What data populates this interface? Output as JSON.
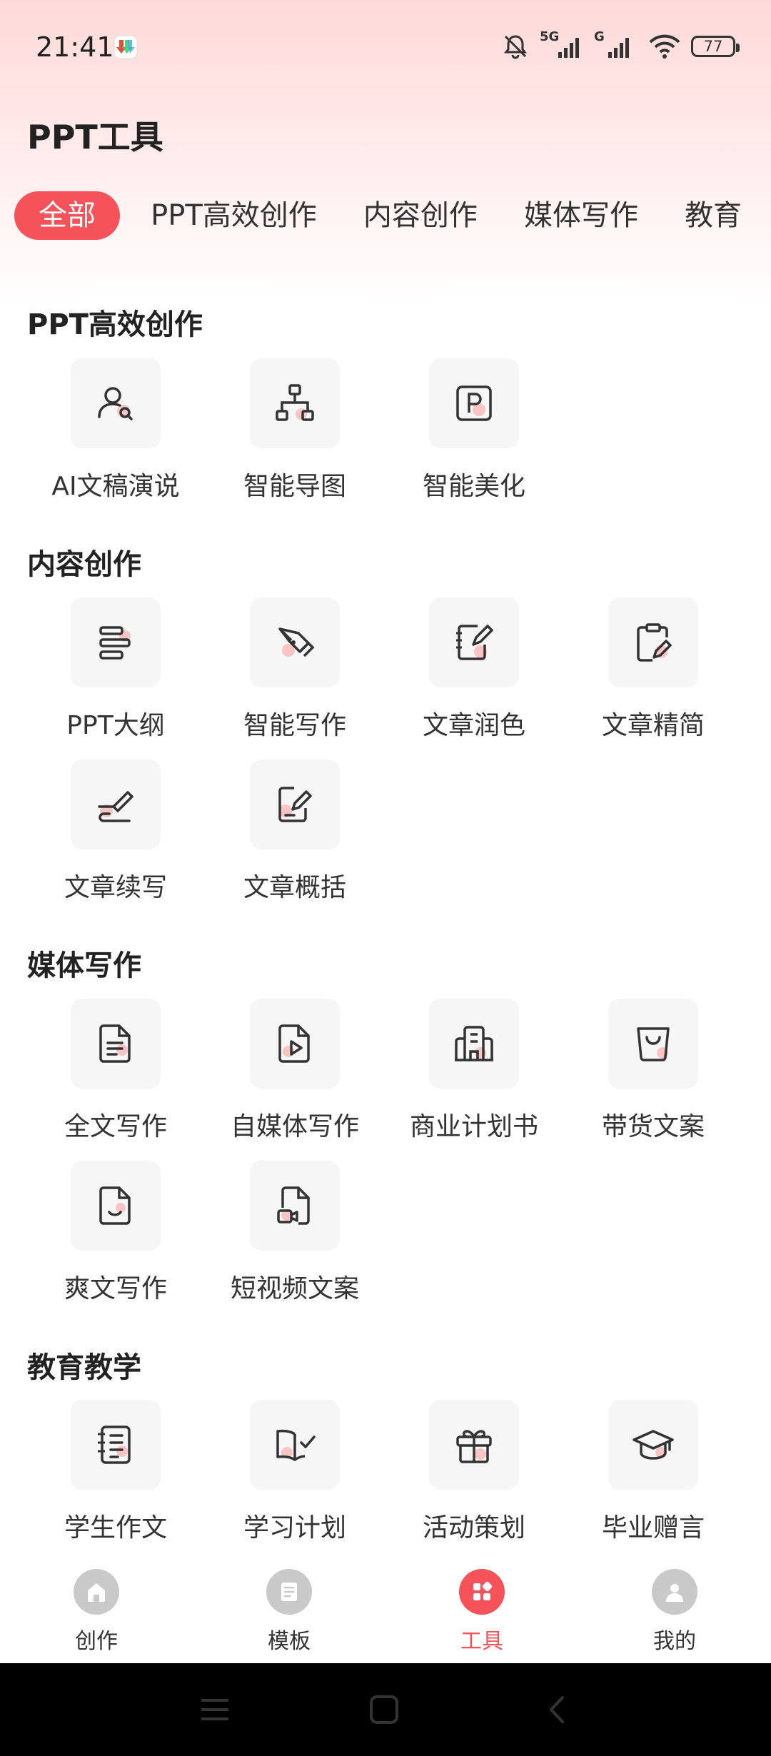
{
  "status_bar": {
    "time": "21:41",
    "battery": "77",
    "network1": "5G",
    "network2": "G"
  },
  "page_title": "PPT工具",
  "tabs": [
    "全部",
    "PPT高效创作",
    "内容创作",
    "媒体写作",
    "教育"
  ],
  "sections": [
    {
      "title": "PPT高效创作",
      "tools": [
        {
          "label": "AI文稿演说",
          "icon": "user-search-icon"
        },
        {
          "label": "智能导图",
          "icon": "mindmap-icon"
        },
        {
          "label": "智能美化",
          "icon": "p-square-icon"
        }
      ]
    },
    {
      "title": "内容创作",
      "tools": [
        {
          "label": "PPT大纲",
          "icon": "outline-icon"
        },
        {
          "label": "智能写作",
          "icon": "pen-nib-icon"
        },
        {
          "label": "文章润色",
          "icon": "notepad-pen-icon"
        },
        {
          "label": "文章精简",
          "icon": "clipboard-pen-icon"
        },
        {
          "label": "文章续写",
          "icon": "signature-icon"
        },
        {
          "label": "文章概括",
          "icon": "doc-pen-icon"
        }
      ]
    },
    {
      "title": "媒体写作",
      "tools": [
        {
          "label": "全文写作",
          "icon": "document-icon"
        },
        {
          "label": "自媒体写作",
          "icon": "video-doc-icon"
        },
        {
          "label": "商业计划书",
          "icon": "building-icon"
        },
        {
          "label": "带货文案",
          "icon": "bag-icon"
        },
        {
          "label": "爽文写作",
          "icon": "smile-doc-icon"
        },
        {
          "label": "短视频文案",
          "icon": "camera-doc-icon"
        }
      ]
    },
    {
      "title": "教育教学",
      "tools": [
        {
          "label": "学生作文",
          "icon": "notebook-icon"
        },
        {
          "label": "学习计划",
          "icon": "book-check-icon"
        },
        {
          "label": "活动策划",
          "icon": "gift-icon"
        },
        {
          "label": "毕业赠言",
          "icon": "graduation-cap-icon"
        }
      ]
    }
  ],
  "bottom_nav": [
    {
      "label": "创作",
      "icon": "home-icon",
      "active": false
    },
    {
      "label": "模板",
      "icon": "template-icon",
      "active": false
    },
    {
      "label": "工具",
      "icon": "grid-icon",
      "active": true
    },
    {
      "label": "我的",
      "icon": "profile-icon",
      "active": false
    }
  ],
  "colors": {
    "accent": "#f5525a",
    "tile_bg": "#f6f6f6",
    "icon_dot": "#f8c4c4"
  }
}
